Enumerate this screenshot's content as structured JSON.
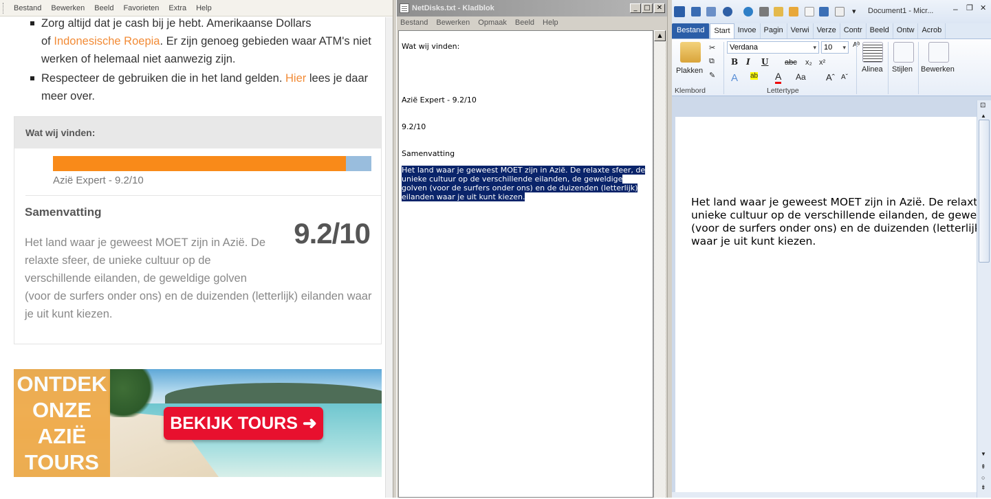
{
  "browser": {
    "menu": [
      "Bestand",
      "Bewerken",
      "Beeld",
      "Favorieten",
      "Extra",
      "Help"
    ],
    "bullet1": {
      "pre": "Zorg altijd dat je cash bij je hebt. Amerikaanse Dollars",
      "of": "of ",
      "link": "Indonesische Roepia",
      "post": ". Er zijn genoeg gebieden waar ATM's niet werken of helemaal niet aanwezig zijn."
    },
    "bullet2": {
      "pre": "Respecteer de gebruiken die in het land gelden. ",
      "link": "Hier",
      "post": " lees je daar meer over."
    },
    "card": {
      "heading": "Wat wij vinden:",
      "rating_label": "Azië Expert - 9.2/10",
      "rating_fraction": 0.92,
      "summary_title": "Samenvatting",
      "score": "9.2/10",
      "summary_text": "Het land waar je geweest MOET zijn in Azië. De relaxte sfeer, de unieke cultuur op de verschillende eilanden, de geweldige golven (voor de surfers onder ons) en de duizenden (letterlijk) eilanden waar je uit kunt kiezen."
    },
    "banner": {
      "lines": [
        "ONTDEK",
        "ONZE",
        "AZIË",
        "TOURS"
      ],
      "cta": "BEKIJK TOURS ➜"
    },
    "colors": {
      "accent": "#f28b36",
      "bar": "#f98a19",
      "cta": "#e8102e"
    }
  },
  "notepad": {
    "title": "NetDisks.txt - Kladblok",
    "menu": [
      "Bestand",
      "Bewerken",
      "Opmaak",
      "Beeld",
      "Help"
    ],
    "lines": [
      "Wat wij vinden:",
      "Azië Expert - 9.2/10",
      "9.2/10",
      "Samenvatting"
    ],
    "selected": "Het land waar je geweest MOET zijn in Azië. De relaxte sfeer, de unieke cultuur op de verschillende eilanden, de geweldige golven (voor de surfers onder ons) en de duizenden (letterlijk) eilanden waar je uit kunt kiezen."
  },
  "word": {
    "title": "Document1 - Micr...",
    "tabs": [
      "Bestand",
      "Start",
      "Invoe",
      "Pagin",
      "Verwi",
      "Verze",
      "Contr",
      "Beeld",
      "Ontw",
      "Acrob"
    ],
    "paste": "Plakken",
    "font": "Verdana",
    "size": "10",
    "groups": {
      "clipboard": "Klembord",
      "font": "Lettertype",
      "paragraph": "Alinea",
      "styles": "Stijlen",
      "edit": "Bewerken"
    },
    "doc_text": "Het land waar je geweest MOET zijn in Azië. De relaxte sfeer, de unieke cultuur op de verschillende eilanden, de geweldige golven (voor de surfers onder ons) en de duizenden (letterlijk) eilanden waar je uit kunt kiezen."
  }
}
